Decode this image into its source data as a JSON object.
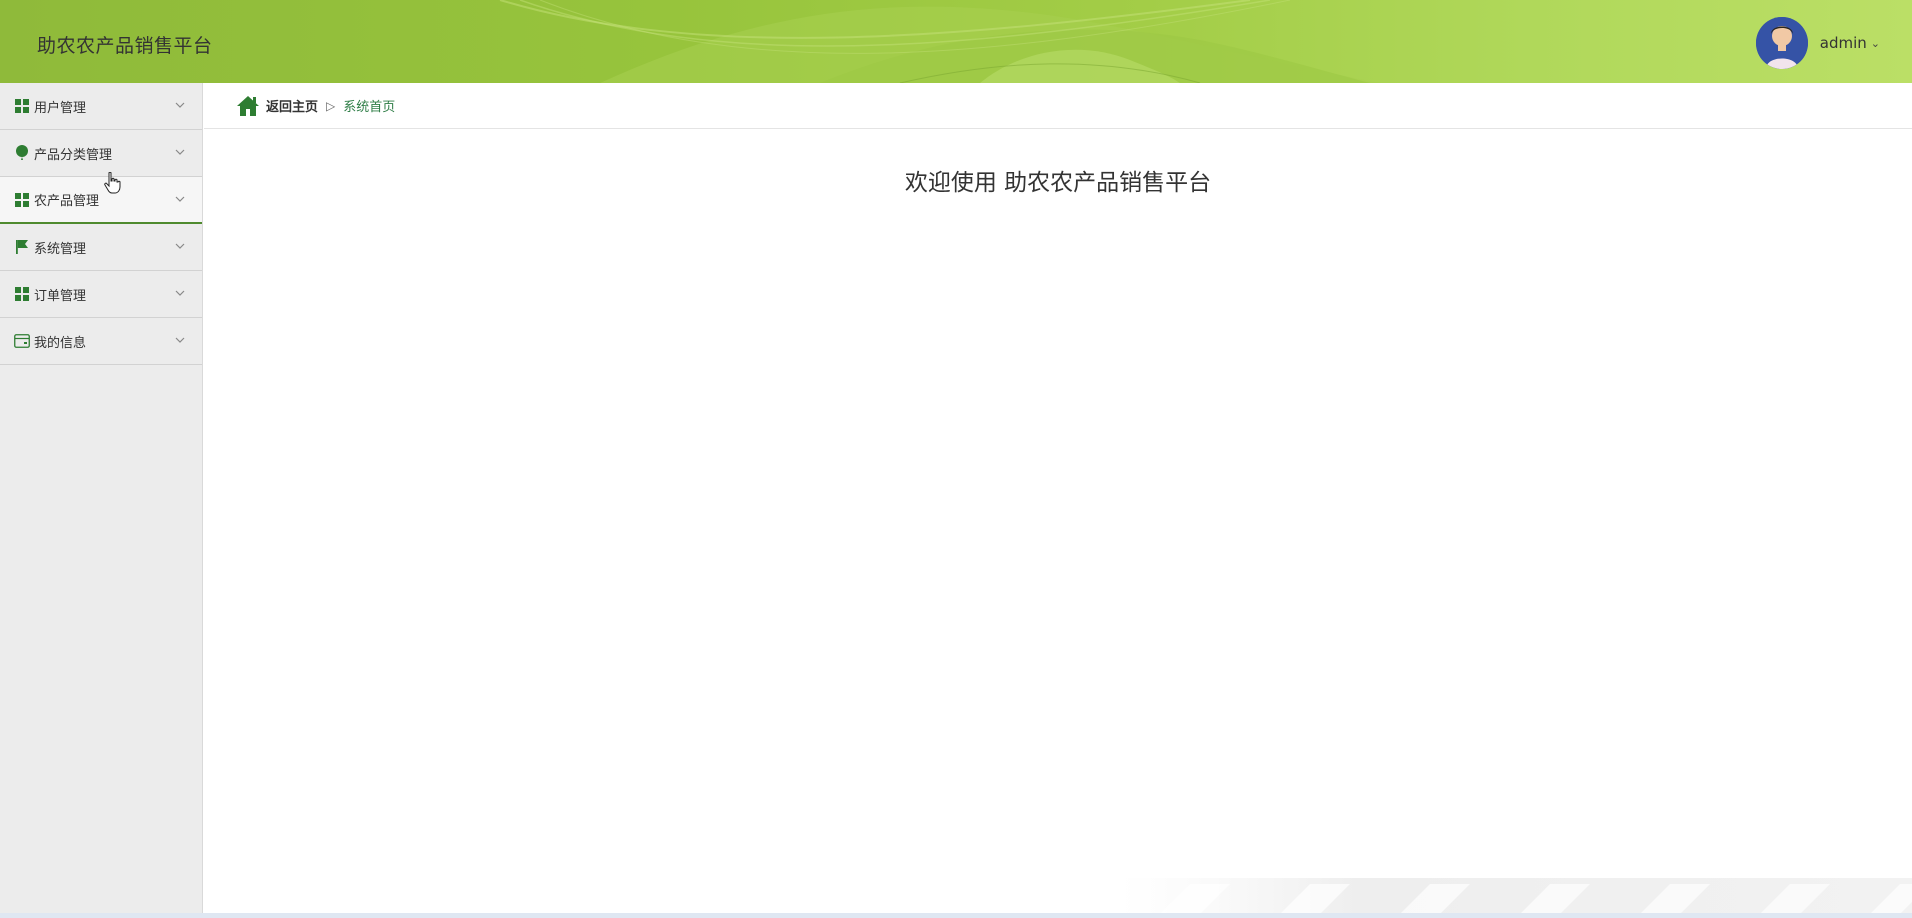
{
  "header": {
    "title": "助农农产品销售平台",
    "user": {
      "name": "admin",
      "caret": "⌄"
    },
    "colors": {
      "header_bg_start": "#8fba3a",
      "header_bg_end": "#bbdf66"
    }
  },
  "sidebar": {
    "items": [
      {
        "label": "用户管理",
        "icon": "grid-icon"
      },
      {
        "label": "产品分类管理",
        "icon": "balloon-icon"
      },
      {
        "label": "农产品管理",
        "icon": "grid-icon"
      },
      {
        "label": "系统管理",
        "icon": "flag-icon"
      },
      {
        "label": "订单管理",
        "icon": "grid-icon"
      },
      {
        "label": "我的信息",
        "icon": "card-icon"
      }
    ],
    "accent": "#2e7d32"
  },
  "breadcrumb": {
    "home": "返回主页",
    "separator": "▷",
    "current": "系统首页"
  },
  "main": {
    "welcome": "欢迎使用 助农农产品销售平台"
  }
}
